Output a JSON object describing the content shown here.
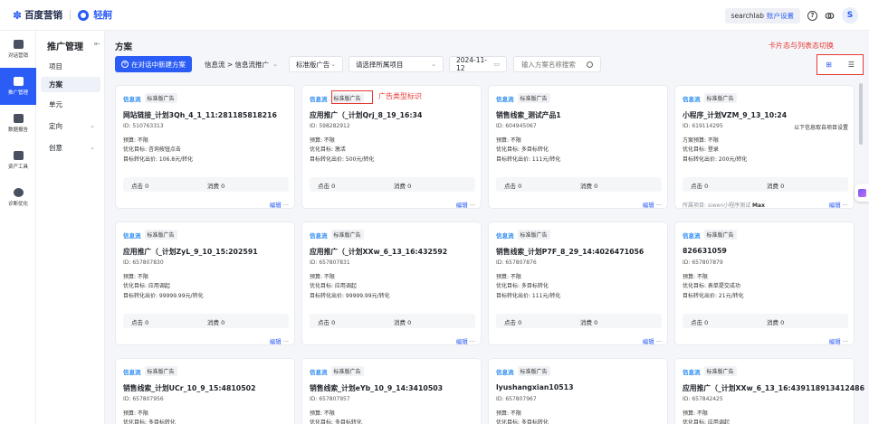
{
  "topbar": {
    "brand": "百度营销",
    "product": "轻舸",
    "account": "searchlab",
    "account_settings": "账户设置",
    "help_icon": "?",
    "avatar": "S"
  },
  "leftnav": [
    {
      "label": "对话营销",
      "icon": "chat-icon"
    },
    {
      "label": "推广管理",
      "icon": "chart-icon"
    },
    {
      "label": "数据报告",
      "icon": "report-icon"
    },
    {
      "label": "资产工具",
      "icon": "toolbox-icon"
    },
    {
      "label": "诊断优化",
      "icon": "diagnose-icon"
    }
  ],
  "subnav": {
    "title": "推广管理",
    "items": [
      "项目",
      "方案",
      "单元",
      "定向",
      "创意"
    ]
  },
  "main": {
    "title": "方案",
    "new_button": "在对话中新建方案",
    "filters": {
      "flow": "信息流 > 信息流推广",
      "ad_type": "标准版广告",
      "project": "请选择所属项目",
      "date": "2024-11-12",
      "search_placeholder": "输入方案名称搜索"
    }
  },
  "annotations": {
    "view_toggle": "卡片态与列表态切换",
    "ad_type_tag": "广告类型标识"
  },
  "cards": [
    {
      "logo": "信息流",
      "type": "标准版广告",
      "name": "网站链接_计划3Qh_4_1_11:281185818216",
      "id": "ID: 510763313",
      "budget": "预算: 不限",
      "goal": "优化目标: 咨询按钮点击",
      "target": "目标转化出价: 106.8元/转化",
      "clicks": "点击 0",
      "cost": "消费 0",
      "edit": "编辑",
      "more": "···"
    },
    {
      "logo": "信息流",
      "type": "标准版广告",
      "name": "应用推广（_计划Qrj_8_19_16:34",
      "id": "ID: 598282912",
      "budget": "预算: 不限",
      "goal": "优化目标: 激活",
      "target": "目标转化出价: 500元/转化",
      "clicks": "点击 0",
      "cost": "消费 0",
      "edit": "编辑",
      "more": "···"
    },
    {
      "logo": "信息流",
      "type": "标准版广告",
      "name": "销售线索_测试产品1",
      "id": "ID: 604945067",
      "budget": "预算: 不限",
      "goal": "优化目标: 多目标转化",
      "target": "目标转化出价: 111元/转化",
      "clicks": "点击 0",
      "cost": "消费 0",
      "edit": "编辑",
      "more": "···"
    },
    {
      "logo": "信息流",
      "type": "标准版广告",
      "name": "小程序_计划VZM_9_13_10:24",
      "id": "ID: 619114295",
      "side_note": "以下信息取自项目设置",
      "budget": "方案预算: 不限",
      "goal": "优化目标: 登录",
      "target": "目标转化出价: 200元/转化",
      "clicks": "点击 0",
      "cost": "消费 0",
      "project_row": "所属项目: siwen小程序测试",
      "project_badge": "Max",
      "edit": "编辑",
      "more": "···"
    },
    {
      "logo": "信息流",
      "type": "标准版广告",
      "name": "应用推广（_计划ZyL_9_10_15:202591",
      "id": "ID: 657807830",
      "budget": "预算: 不限",
      "goal": "优化目标: 应用调起",
      "target": "目标转化出价: 99999.99元/转化",
      "clicks": "点击 0",
      "cost": "消费 0",
      "edit": "编辑",
      "more": "···"
    },
    {
      "logo": "信息流",
      "type": "标准版广告",
      "name": "应用推广（_计划XXw_6_13_16:432592",
      "id": "ID: 657807831",
      "budget": "预算: 不限",
      "goal": "优化目标: 应用调起",
      "target": "目标转化出价: 99999.99元/转化",
      "clicks": "点击 0",
      "cost": "消费 0",
      "edit": "编辑",
      "more": "···"
    },
    {
      "logo": "信息流",
      "type": "标准版广告",
      "name": "销售线索_计划P7F_8_29_14:4026471056",
      "id": "ID: 657807876",
      "budget": "预算: 不限",
      "goal": "优化目标: 多目标转化",
      "target": "目标转化出价: 111元/转化",
      "clicks": "点击 0",
      "cost": "消费 0",
      "edit": "编辑",
      "more": "···"
    },
    {
      "logo": "信息流",
      "type": "标准版广告",
      "name": "826631059",
      "id": "ID: 657807879",
      "budget": "预算: 不限",
      "goal": "优化目标: 表单提交成功",
      "target": "目标转化出价: 21元/转化",
      "clicks": "点击 0",
      "cost": "消费 0",
      "edit": "编辑",
      "more": "···"
    },
    {
      "logo": "信息流",
      "type": "标准版广告",
      "name": "销售线索_计划UCr_10_9_15:4810502",
      "id": "ID: 657807956",
      "budget": "预算: 不限",
      "goal": "优化目标: 多目标转化"
    },
    {
      "logo": "信息流",
      "type": "标准版广告",
      "name": "销售线索_计划eYb_10_9_14:3410503",
      "id": "ID: 657807957",
      "budget": "预算: 不限",
      "goal": "优化目标: 多目标转化"
    },
    {
      "logo": "信息流",
      "type": "标准版广告",
      "name": "lyushangxian10513",
      "id": "ID: 657807967",
      "budget": "预算: 不限",
      "goal": "优化目标: 多目标转化"
    },
    {
      "logo": "信息流",
      "type": "标准版广告",
      "name": "应用推广（_计划XXw_6_13_16:439118913412486",
      "id": "ID: 657842425",
      "budget": "预算: 不限",
      "goal": "优化目标: 应用调起"
    }
  ]
}
